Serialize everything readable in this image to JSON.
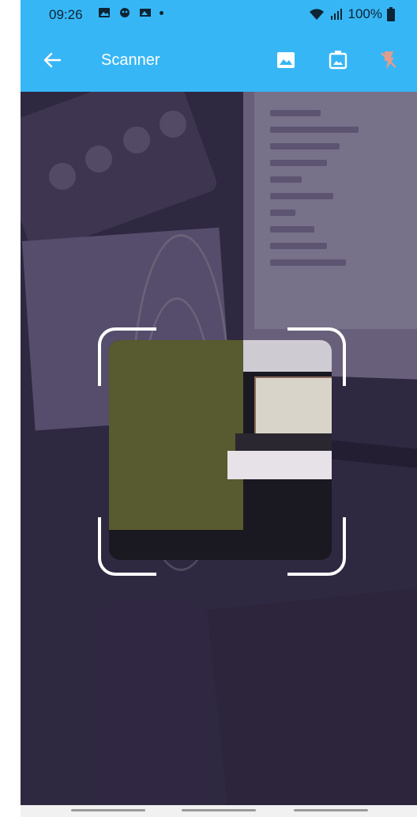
{
  "status_bar": {
    "time": "09:26",
    "battery": "100%"
  },
  "app_bar": {
    "title": "Scanner",
    "actions": [
      "gallery-icon",
      "image-frame-icon",
      "flash-off-icon"
    ]
  },
  "colors": {
    "primary": "#37b6f6",
    "frame": "#ffffff"
  }
}
